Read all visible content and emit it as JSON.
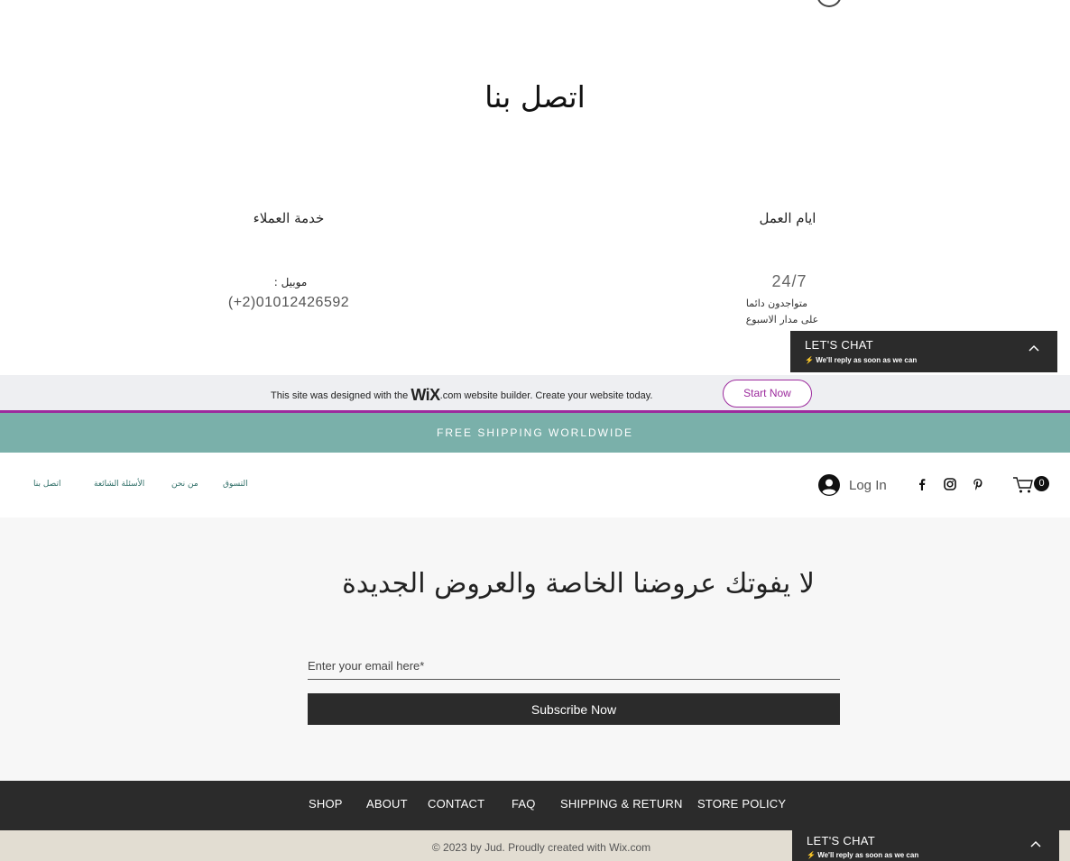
{
  "contact": {
    "title": "اتصل بنا",
    "customer_service": {
      "heading": "خدمة العملاء",
      "mobile_label": ": موبيل",
      "mobile_number": "(+2)01012426592"
    },
    "working_days": {
      "heading": "ايام العمل",
      "hours": "24/7",
      "line1": "متواجدون دائما",
      "line2": "على مدار الاسبوع"
    }
  },
  "chat_widget": {
    "title": "LET'S CHAT",
    "subtitle": "We'll reply as soon as we can",
    "icon": "chevron-up-icon"
  },
  "wix_banner": {
    "text_before": "This site was designed with the",
    "logo": "WiX",
    "text_after": ".com website builder. Create your website today.",
    "button": "Start Now",
    "accent_color": "#9c2a9d"
  },
  "shipping_bar": {
    "text": "FREE SHIPPING WORLDWIDE",
    "color": "#7ab0aa"
  },
  "header": {
    "nav": [
      "التسوق",
      "من نحن",
      "الأسئلة الشائعة",
      "اتصل بنا"
    ],
    "login": "Log In",
    "social_icons": [
      "facebook-icon",
      "instagram-icon",
      "pinterest-icon"
    ],
    "cart_count": "0"
  },
  "subscribe": {
    "title": "لا يفوتك عروضنا الخاصة والعروض الجديدة",
    "email_placeholder": "Enter your email here*",
    "button": "Subscribe Now"
  },
  "footer": {
    "links": [
      "SHOP",
      "ABOUT",
      "CONTACT",
      "FAQ",
      "SHIPPING & RETURN",
      "STORE POLICY"
    ],
    "copyright": "© 2023 by Jud. Proudly created with Wix.com"
  }
}
